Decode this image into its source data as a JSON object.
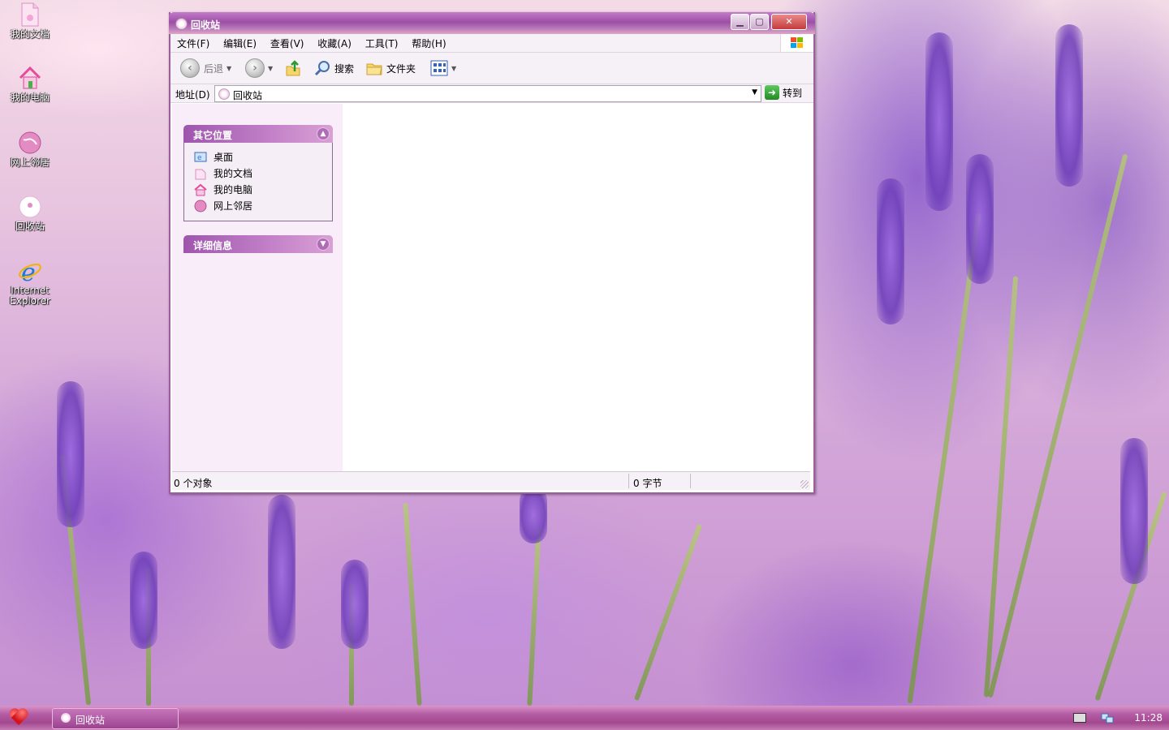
{
  "desktop": {
    "icons": [
      {
        "label": "我的文档"
      },
      {
        "label": "我的电脑"
      },
      {
        "label": "网上邻居"
      },
      {
        "label": "回收站"
      },
      {
        "label": "Internet Explorer"
      }
    ]
  },
  "window": {
    "title": "回收站",
    "menu": [
      {
        "label": "文件(F)"
      },
      {
        "label": "编辑(E)"
      },
      {
        "label": "查看(V)"
      },
      {
        "label": "收藏(A)"
      },
      {
        "label": "工具(T)"
      },
      {
        "label": "帮助(H)"
      }
    ],
    "toolbar": {
      "back_label": "后退",
      "search_label": "搜索",
      "folders_label": "文件夹"
    },
    "address": {
      "label": "地址(D)",
      "value": "回收站",
      "go_label": "转到"
    },
    "sidepanel": {
      "other_places_title": "其它位置",
      "links": [
        {
          "label": "桌面"
        },
        {
          "label": "我的文档"
        },
        {
          "label": "我的电脑"
        },
        {
          "label": "网上邻居"
        }
      ],
      "details_title": "详细信息"
    },
    "status": {
      "objects": "0 个对象",
      "bytes": "0 字节"
    }
  },
  "taskbar": {
    "task_label": "回收站",
    "clock": "11:28"
  },
  "colors": {
    "accent": "#9d4fa6",
    "pane": "#f8edf8"
  }
}
